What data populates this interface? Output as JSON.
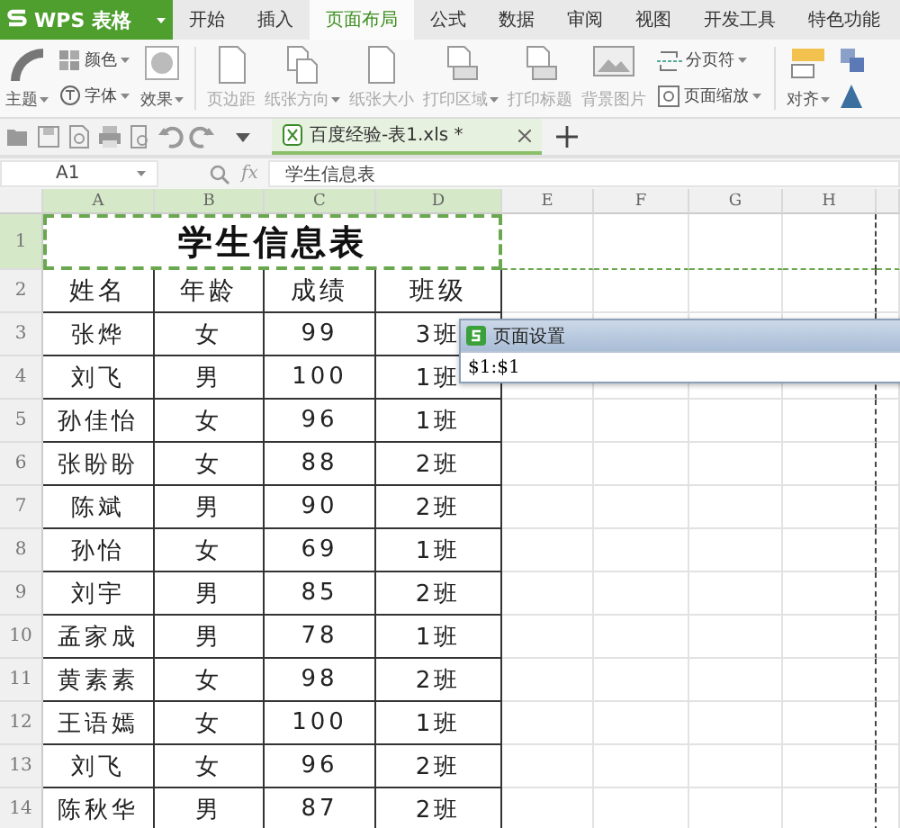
{
  "app": {
    "name": "WPS 表格"
  },
  "menu_tabs": [
    {
      "label": "开始",
      "selected": false
    },
    {
      "label": "插入",
      "selected": false
    },
    {
      "label": "页面布局",
      "selected": true
    },
    {
      "label": "公式",
      "selected": false
    },
    {
      "label": "数据",
      "selected": false
    },
    {
      "label": "审阅",
      "selected": false
    },
    {
      "label": "视图",
      "selected": false
    },
    {
      "label": "开发工具",
      "selected": false
    },
    {
      "label": "特色功能",
      "selected": false
    }
  ],
  "ribbon": [
    {
      "kind": "large",
      "label": "主题",
      "dropdown": true,
      "disabled": false
    },
    {
      "kind": "stack",
      "items": [
        {
          "label": "颜色",
          "dropdown": true,
          "disabled": false
        },
        {
          "label": "字体",
          "dropdown": true,
          "disabled": false
        }
      ]
    },
    {
      "kind": "large",
      "label": "效果",
      "dropdown": true,
      "disabled": false
    },
    {
      "kind": "separator"
    },
    {
      "kind": "large",
      "label": "页边距",
      "dropdown": false,
      "disabled": true
    },
    {
      "kind": "large",
      "label": "纸张方向",
      "dropdown": true,
      "disabled": true
    },
    {
      "kind": "large",
      "label": "纸张大小",
      "dropdown": false,
      "disabled": true
    },
    {
      "kind": "large",
      "label": "打印区域",
      "dropdown": true,
      "disabled": true
    },
    {
      "kind": "large",
      "label": "打印标题",
      "dropdown": false,
      "disabled": true
    },
    {
      "kind": "large",
      "label": "背景图片",
      "dropdown": false,
      "disabled": true
    },
    {
      "kind": "stack",
      "items": [
        {
          "label": "分页符",
          "dropdown": true,
          "disabled": false
        },
        {
          "label": "页面缩放",
          "dropdown": true,
          "disabled": false
        }
      ]
    },
    {
      "kind": "separator"
    },
    {
      "kind": "large",
      "label": "对齐",
      "dropdown": true,
      "disabled": false
    }
  ],
  "document_tab": {
    "title": "百度经验-表1.xls *"
  },
  "formula_bar": {
    "cell": "A1",
    "fx_label": "fx",
    "formula": "学生信息表"
  },
  "sheet": {
    "columns": [
      {
        "label": "A",
        "selected": true
      },
      {
        "label": "B",
        "selected": true
      },
      {
        "label": "C",
        "selected": true
      },
      {
        "label": "D",
        "selected": true
      },
      {
        "label": "E",
        "selected": false
      },
      {
        "label": "F",
        "selected": false
      },
      {
        "label": "G",
        "selected": false
      },
      {
        "label": "H",
        "selected": false
      }
    ],
    "title_row": {
      "number": "1",
      "selected": true,
      "text": "学生信息表"
    },
    "rows": [
      {
        "number": "2",
        "selected": false,
        "kind": "header",
        "cells": [
          "姓名",
          "年龄",
          "成绩",
          "班级"
        ]
      },
      {
        "number": "3",
        "selected": false,
        "kind": "data",
        "cells": [
          "张烨",
          "女",
          "99",
          "3班"
        ]
      },
      {
        "number": "4",
        "selected": false,
        "kind": "data",
        "cells": [
          "刘飞",
          "男",
          "100",
          "1班"
        ]
      },
      {
        "number": "5",
        "selected": false,
        "kind": "data",
        "cells": [
          "孙佳怡",
          "女",
          "96",
          "1班"
        ]
      },
      {
        "number": "6",
        "selected": false,
        "kind": "data",
        "cells": [
          "张盼盼",
          "女",
          "88",
          "2班"
        ]
      },
      {
        "number": "7",
        "selected": false,
        "kind": "data",
        "cells": [
          "陈斌",
          "男",
          "90",
          "2班"
        ]
      },
      {
        "number": "8",
        "selected": false,
        "kind": "data",
        "cells": [
          "孙怡",
          "女",
          "69",
          "1班"
        ]
      },
      {
        "number": "9",
        "selected": false,
        "kind": "data",
        "cells": [
          "刘宇",
          "男",
          "85",
          "2班"
        ]
      },
      {
        "number": "10",
        "selected": false,
        "kind": "data",
        "cells": [
          "孟家成",
          "男",
          "78",
          "1班"
        ]
      },
      {
        "number": "11",
        "selected": false,
        "kind": "data",
        "cells": [
          "黄素素",
          "女",
          "98",
          "2班"
        ]
      },
      {
        "number": "12",
        "selected": false,
        "kind": "data",
        "cells": [
          "王语嫣",
          "女",
          "100",
          "1班"
        ]
      },
      {
        "number": "13",
        "selected": false,
        "kind": "data",
        "cells": [
          "刘飞",
          "女",
          "96",
          "2班"
        ]
      },
      {
        "number": "14",
        "selected": false,
        "kind": "data",
        "cells": [
          "陈秋华",
          "男",
          "87",
          "2班"
        ]
      }
    ]
  },
  "dialog": {
    "title": "页面设置",
    "value": "$1:$1"
  }
}
